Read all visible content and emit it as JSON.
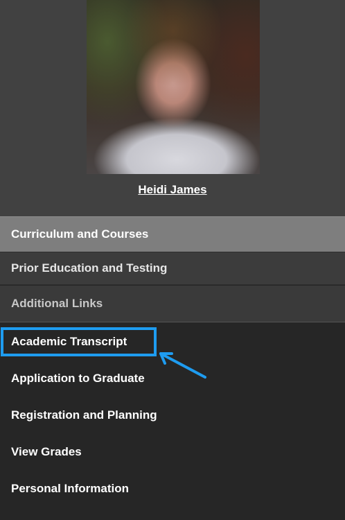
{
  "profile": {
    "name": "Heidi James"
  },
  "nav": [
    {
      "label": "Curriculum and Courses"
    },
    {
      "label": "Prior Education and Testing"
    },
    {
      "label": "Additional Links"
    }
  ],
  "links": [
    {
      "label": "Academic Transcript"
    },
    {
      "label": "Application to Graduate"
    },
    {
      "label": "Registration and Planning"
    },
    {
      "label": "View Grades"
    },
    {
      "label": "Personal Information"
    }
  ],
  "colors": {
    "highlight": "#1e9cf0",
    "active_tab": "#7e7e7e",
    "background": "#262626"
  }
}
